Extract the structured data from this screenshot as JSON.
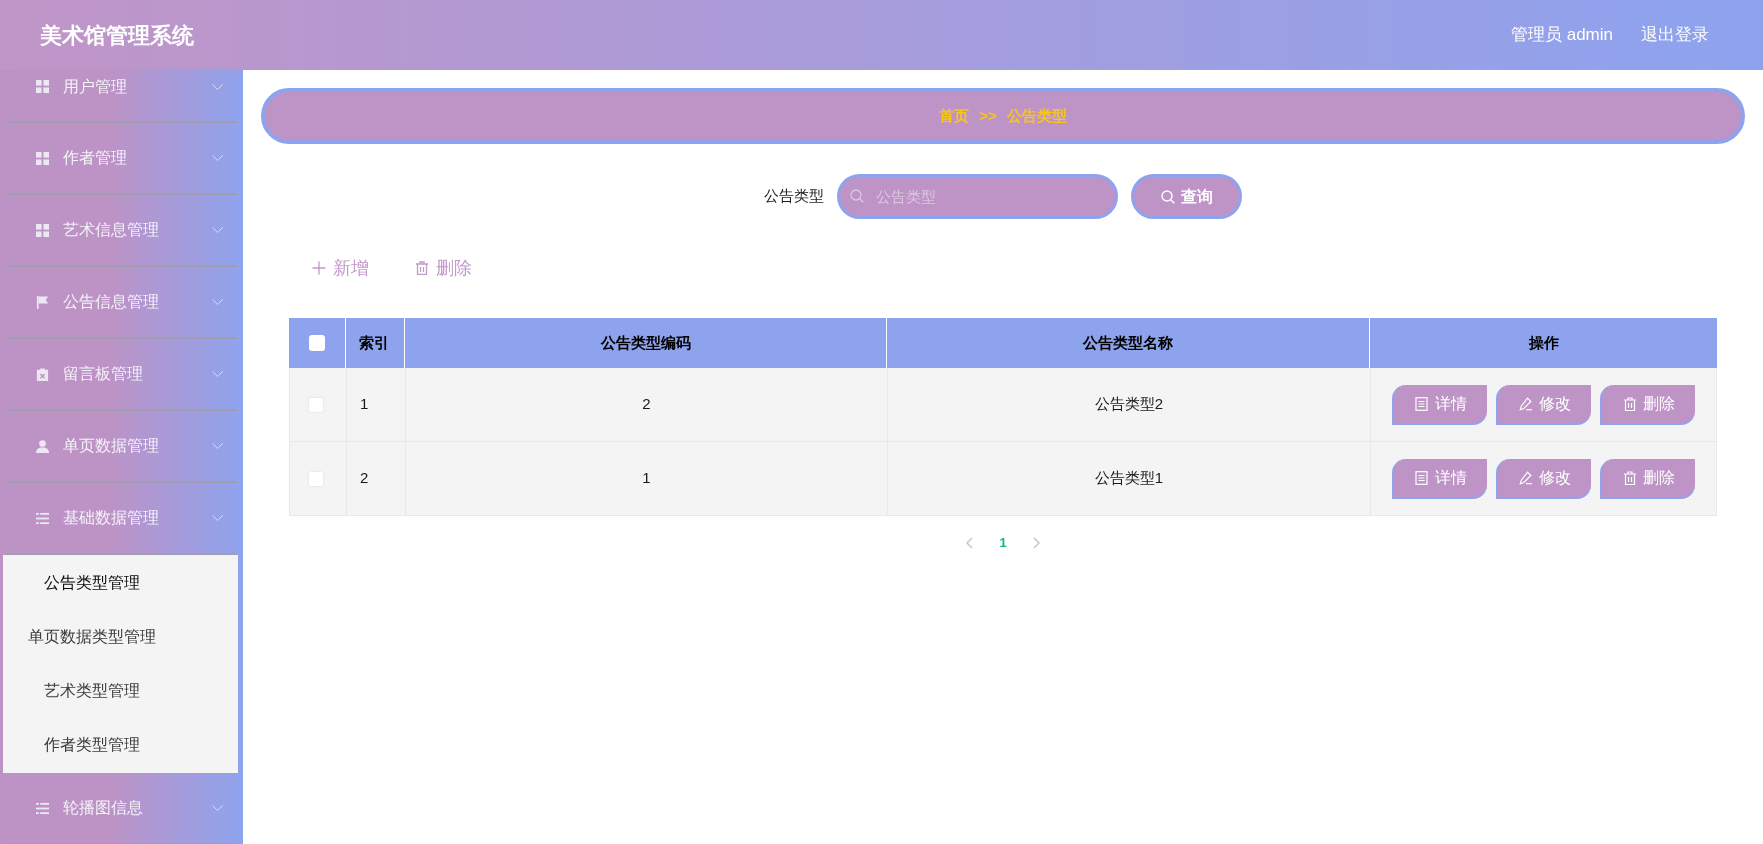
{
  "header": {
    "title": "美术馆管理系统",
    "user": "管理员 admin",
    "logout": "退出登录"
  },
  "sidebar": {
    "menu": [
      {
        "label": "用户管理",
        "kind": "grid"
      },
      {
        "label": "作者管理",
        "kind": "grid"
      },
      {
        "label": "艺术信息管理",
        "kind": "grid"
      },
      {
        "label": "公告信息管理",
        "kind": "flag"
      },
      {
        "label": "留言板管理",
        "kind": "clipboard"
      },
      {
        "label": "单页数据管理",
        "kind": "person"
      },
      {
        "label": "基础数据管理",
        "kind": "list",
        "expanded": true,
        "children": [
          {
            "label": "公告类型管理",
            "selected": true
          },
          {
            "label": "单页数据类型管理",
            "selected": false
          },
          {
            "label": "艺术类型管理",
            "selected": false
          },
          {
            "label": "作者类型管理",
            "selected": false
          }
        ]
      },
      {
        "label": "轮播图信息",
        "kind": "list"
      }
    ]
  },
  "breadcrumb": {
    "items": [
      "首页",
      "公告类型"
    ],
    "separator": ">>"
  },
  "search": {
    "label": "公告类型",
    "placeholder": "公告类型",
    "button": "查询"
  },
  "toolbar": [
    {
      "label": "新增",
      "kind": "add"
    },
    {
      "label": "删除",
      "kind": "delete"
    }
  ],
  "table": {
    "select_all_checked": false,
    "columns": [
      "索引",
      "公告类型编码",
      "公告类型名称",
      "操作"
    ],
    "rows": [
      {
        "checked": false,
        "cells": [
          "1",
          "2",
          "公告类型2"
        ],
        "actions": [
          {
            "label": "详情",
            "kind": "detail"
          },
          {
            "label": "修改",
            "kind": "edit"
          },
          {
            "label": "删除",
            "kind": "delete"
          }
        ]
      },
      {
        "checked": false,
        "cells": [
          "2",
          "1",
          "公告类型1"
        ],
        "actions": [
          {
            "label": "详情",
            "kind": "detail"
          },
          {
            "label": "修改",
            "kind": "edit"
          },
          {
            "label": "删除",
            "kind": "delete"
          }
        ]
      }
    ]
  },
  "pagination": {
    "prev_disabled": true,
    "pages": [
      {
        "label": "1",
        "selected": true
      }
    ],
    "next_disabled": true
  }
}
